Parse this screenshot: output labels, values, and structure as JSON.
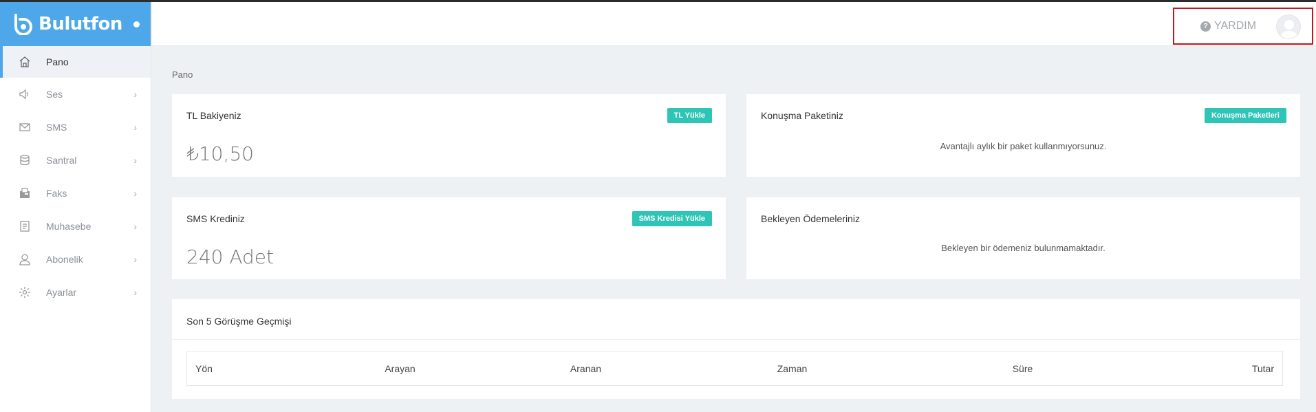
{
  "brand": {
    "name": "Bulutfon"
  },
  "header": {
    "help_label": "YARDIM"
  },
  "sidebar": {
    "items": [
      {
        "label": "Pano",
        "icon": "home-icon"
      },
      {
        "label": "Ses",
        "icon": "speaker-icon"
      },
      {
        "label": "SMS",
        "icon": "envelope-icon"
      },
      {
        "label": "Santral",
        "icon": "database-icon"
      },
      {
        "label": "Faks",
        "icon": "fax-icon"
      },
      {
        "label": "Muhasebe",
        "icon": "document-icon"
      },
      {
        "label": "Abonelik",
        "icon": "user-icon"
      },
      {
        "label": "Ayarlar",
        "icon": "gear-icon"
      }
    ]
  },
  "breadcrumb": "Pano",
  "cards": {
    "tl": {
      "title": "TL Bakiyeniz",
      "button": "TL Yükle",
      "value": "₺10,50"
    },
    "package": {
      "title": "Konuşma Paketiniz",
      "button": "Konuşma Paketleri",
      "message": "Avantajlı aylık bir paket kullanmıyorsunuz."
    },
    "sms": {
      "title": "SMS Krediniz",
      "button": "SMS Kredisi Yükle",
      "value": "240 Adet"
    },
    "payments": {
      "title": "Bekleyen Ödemeleriniz",
      "message": "Bekleyen bir ödemeniz bulunmamaktadır."
    }
  },
  "history": {
    "title": "Son 5 Görüşme Geçmişi",
    "columns": [
      "Yön",
      "Arayan",
      "Aranan",
      "Zaman",
      "Süre",
      "Tutar"
    ]
  },
  "colors": {
    "brand": "#4da7e8",
    "accent": "#2ec4b6",
    "highlight_border": "#c4161c"
  }
}
